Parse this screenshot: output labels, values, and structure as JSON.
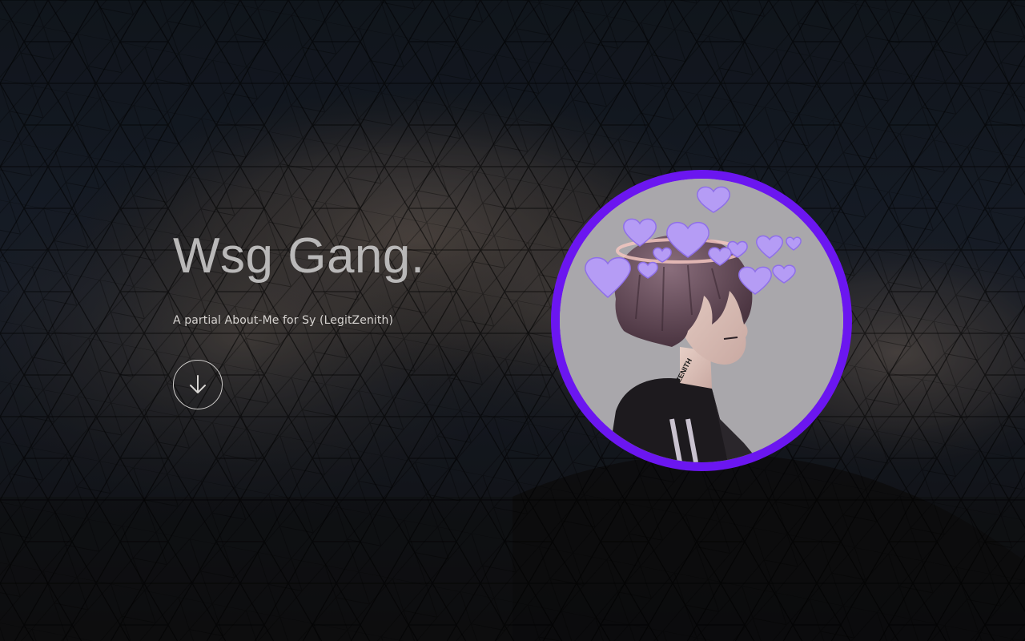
{
  "hero": {
    "title": "Wsg Gang.",
    "subtitle": "A partial About-Me for Sy (LegitZenith)",
    "scroll_icon": "arrow-down-icon"
  },
  "avatar": {
    "tattoo_text": "ZENITH",
    "ring_color": "#6b16f0",
    "heart_color": "#b59cf5"
  },
  "colors": {
    "background": "#15171c",
    "title": "#b9b8b8",
    "subtitle": "#d6d3d0"
  }
}
